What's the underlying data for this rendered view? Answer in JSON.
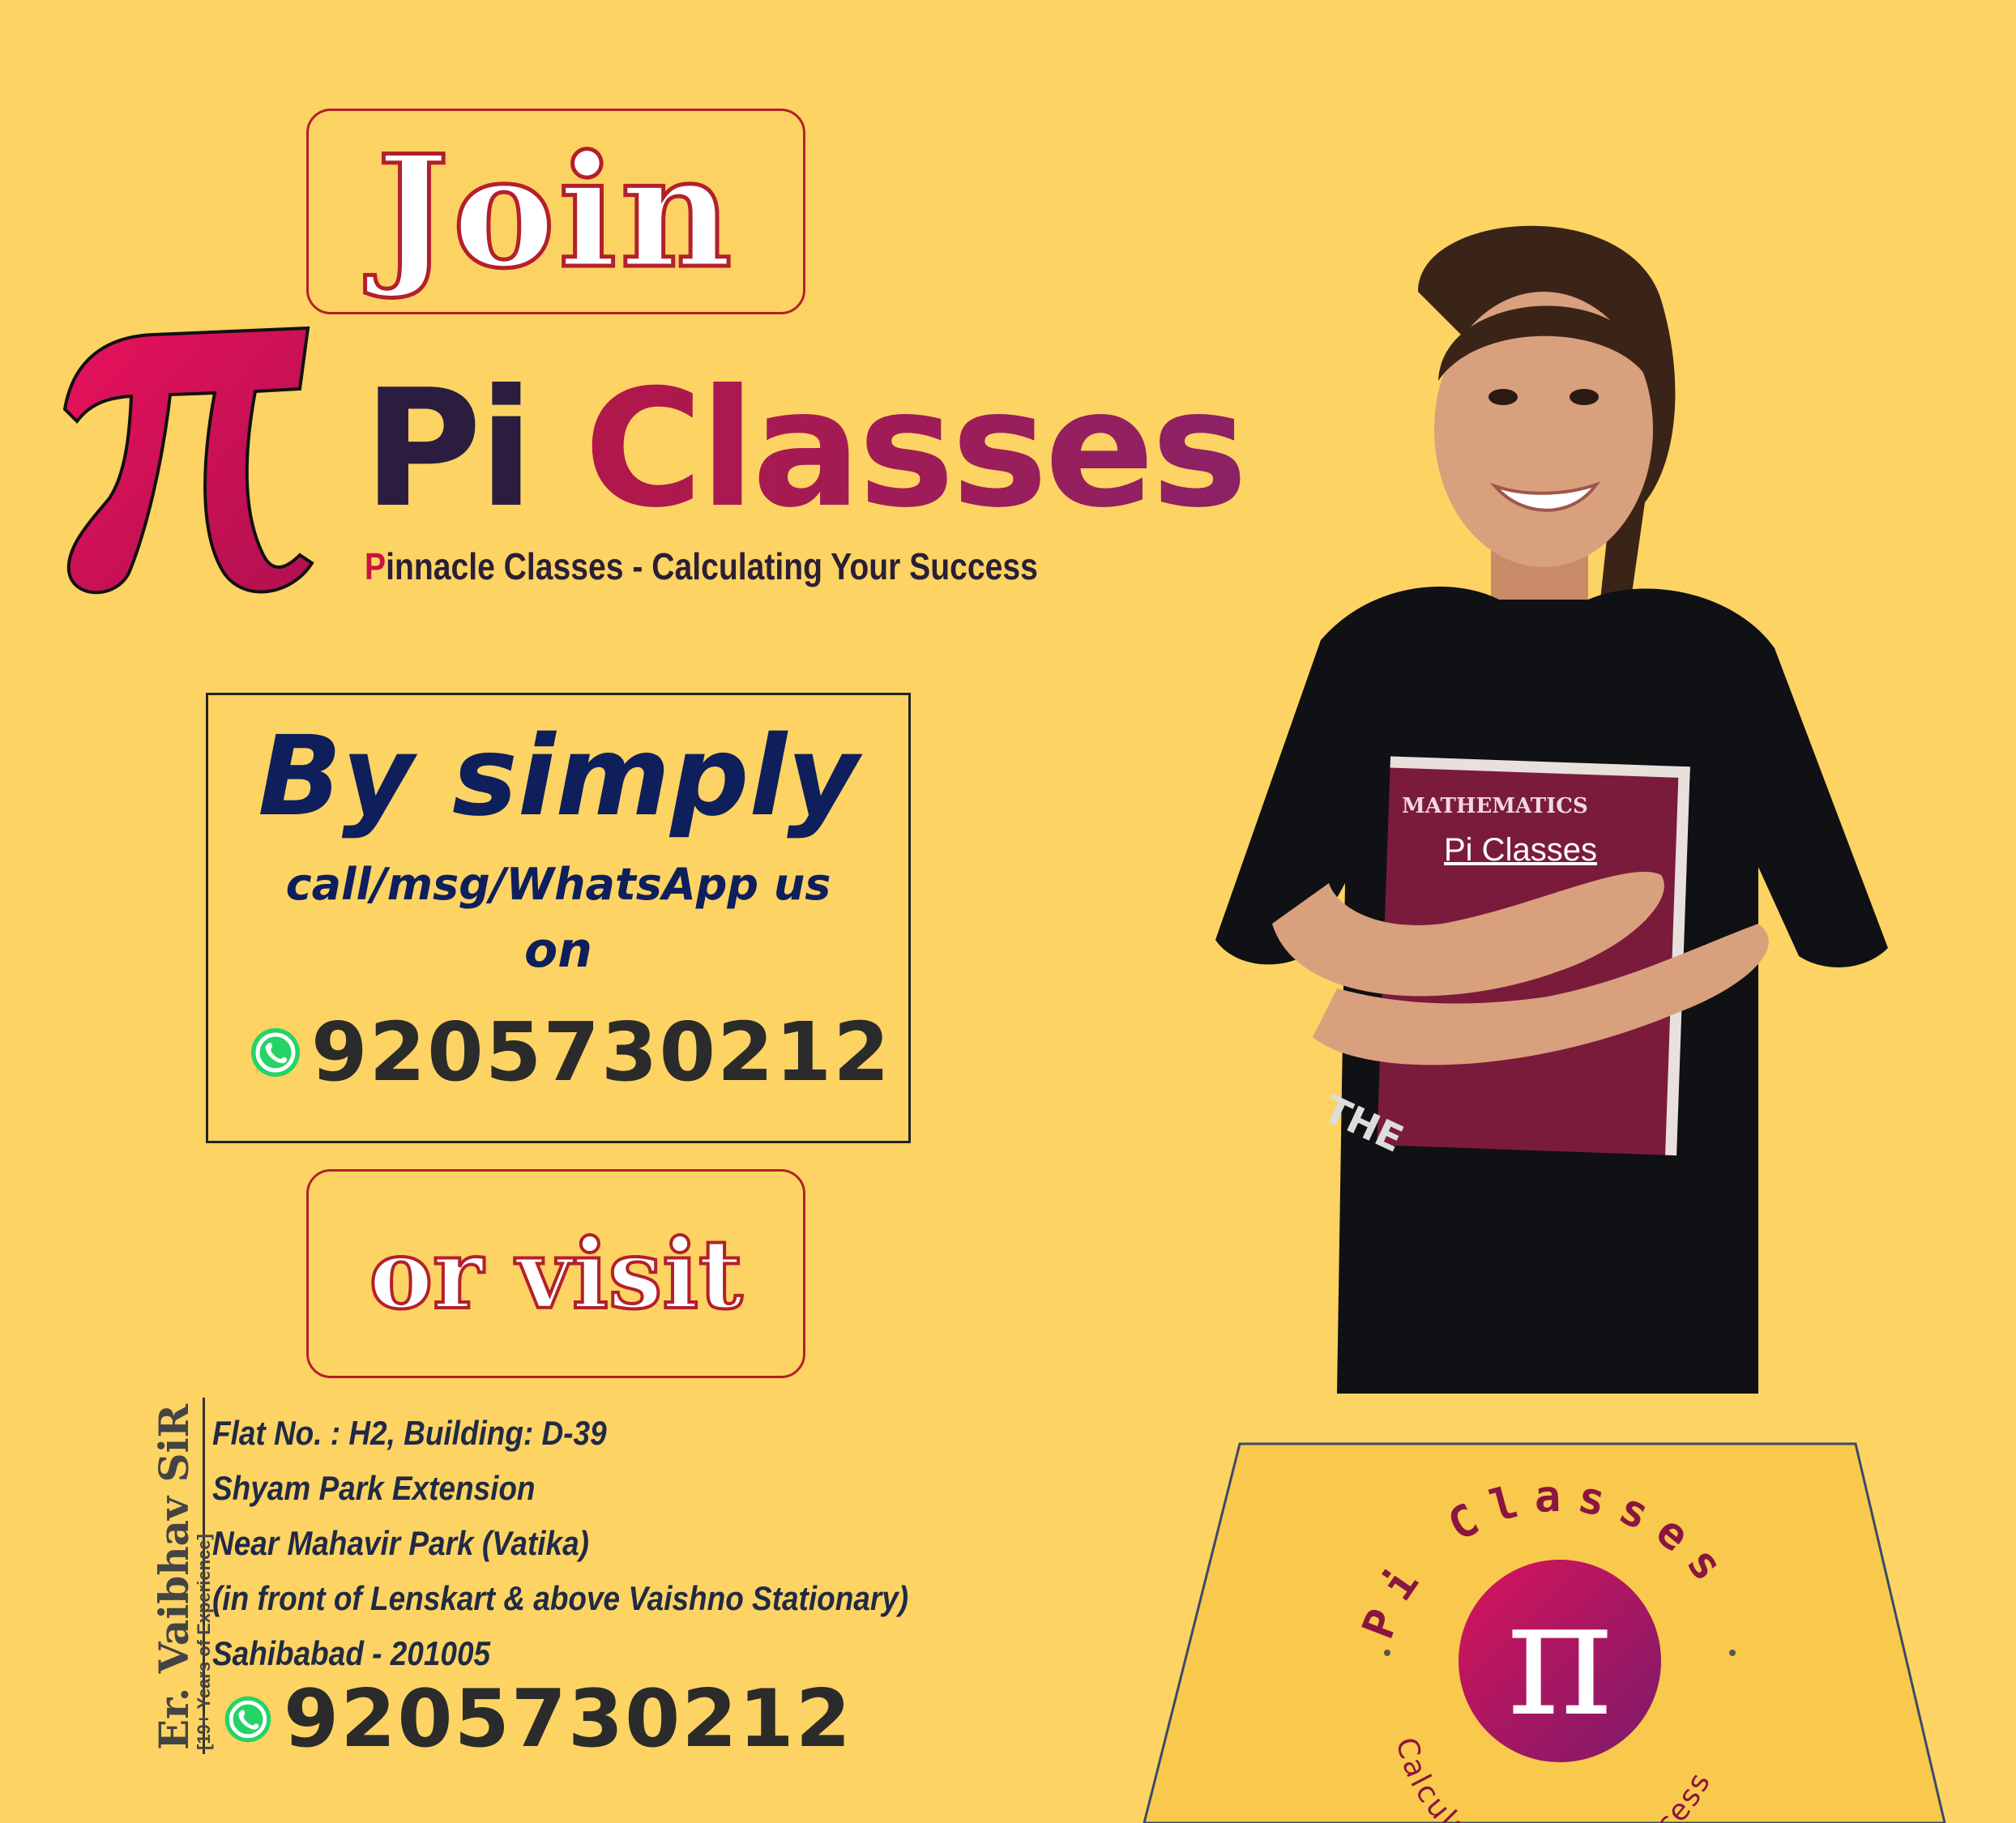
{
  "join": "Join",
  "brand": {
    "pi_word": "Pi",
    "classes_word": "Classes",
    "tagline_first": "P",
    "tagline_rest": "innacle Classes - Calculating Your Success"
  },
  "contact": {
    "headline": "By simply",
    "subline": "call/msg/WhatsApp us",
    "on": "on",
    "phone": "9205730212"
  },
  "visit": "or visit",
  "teacher": {
    "name": "Er. Vaibhav SiR",
    "experience": "[19+ Years of Experience]"
  },
  "address": [
    "Flat No. : H2, Building: D-39",
    "Shyam Park Extension",
    "Near Mahavir Park (Vatika)",
    "(in front of Lenskart & above Vaishno Stationary)",
    "Sahibabad - 201005"
  ],
  "address_phone": "9205730212",
  "book": {
    "subject": "MATHEMATICS",
    "label": "Pi Classes"
  },
  "logo": {
    "top_text": "Pi Classes",
    "bottom_text": "Calculating Your Success",
    "symbol": "π"
  },
  "colors": {
    "background": "#fdd363",
    "brand_red": "#c8133d",
    "navy": "#0e1f5c",
    "whatsapp": "#25d366"
  },
  "icons": [
    "whatsapp-icon",
    "pi-icon"
  ]
}
